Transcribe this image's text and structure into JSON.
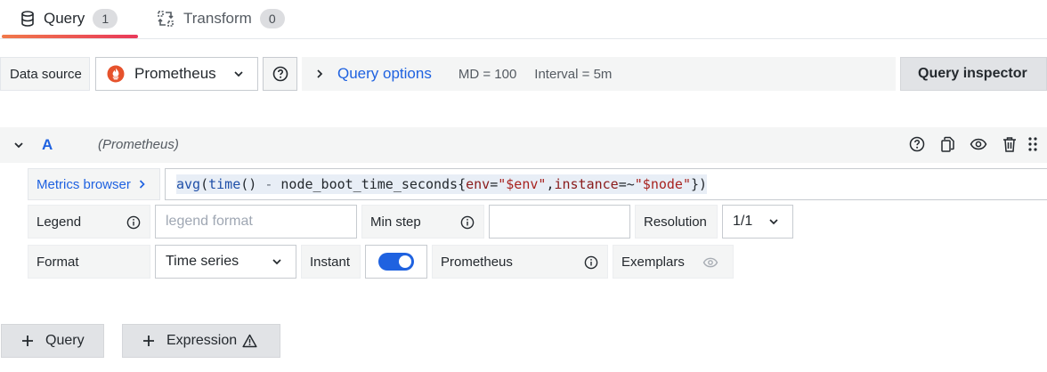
{
  "tabs": [
    {
      "label": "Query",
      "count": "1",
      "icon": "database-icon",
      "active": true
    },
    {
      "label": "Transform",
      "count": "0",
      "icon": "transform-icon",
      "active": false
    }
  ],
  "datasource": {
    "label": "Data source",
    "selected": "Prometheus",
    "icon": "prometheus-logo-icon",
    "brand_color": "#e6522c"
  },
  "query_options": {
    "title": "Query options",
    "md": "MD = 100",
    "interval": "Interval = 5m"
  },
  "inspector_label": "Query inspector",
  "query": {
    "ref_id": "A",
    "datasource_name": "(Prometheus)",
    "metrics_browser_label": "Metrics browser",
    "expr_tokens": {
      "t1": "avg",
      "t2": "(",
      "t3": "time",
      "t4": "()",
      "t5": " - ",
      "t6": "node_boot_time_seconds",
      "t7": "{",
      "t8": "env",
      "t9": "=",
      "t10": "\"$env\"",
      "t11": ",",
      "t12": "instance",
      "t13": "=~",
      "t14": "\"$node\"",
      "t15": "})"
    },
    "legend_label": "Legend",
    "legend_placeholder": "legend format",
    "legend_value": "",
    "min_step_label": "Min step",
    "min_step_value": "",
    "resolution_label": "Resolution",
    "resolution_value": "1/1",
    "format_label": "Format",
    "format_value": "Time series",
    "instant_label": "Instant",
    "instant_on": true,
    "prometheus_label": "Prometheus",
    "exemplars_label": "Exemplars"
  },
  "buttons": {
    "add_query": "Query",
    "add_expression": "Expression"
  },
  "colors": {
    "accent_blue": "#1f62e0",
    "tab_gradient_start": "#f0794a",
    "tab_gradient_end": "#e9395a"
  }
}
